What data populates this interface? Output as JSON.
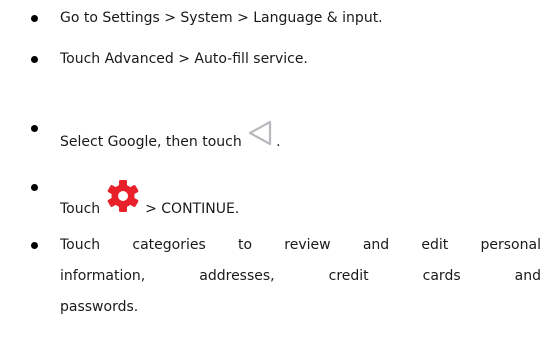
{
  "steps": [
    {
      "text": "Go to Settings > System > Language & input."
    },
    {
      "text": "Touch Advanced > Auto-fill service."
    },
    {
      "before": "Select Google, then touch ",
      "after": ".",
      "icon": "back-triangle-icon"
    },
    {
      "before": "Touch ",
      "after": " > CONTINUE.",
      "icon": "gear-icon"
    },
    {
      "lines": [
        [
          "Touch",
          "categories",
          "to",
          "review",
          "and",
          "edit",
          "personal"
        ],
        [
          "information,",
          "addresses,",
          "credit",
          "cards",
          "and"
        ],
        [
          "passwords."
        ]
      ]
    }
  ],
  "colors": {
    "gear": "#e8202a",
    "back_icon": "#b9b9bd",
    "text": "#1a1a1a",
    "bullet": "#000000"
  }
}
